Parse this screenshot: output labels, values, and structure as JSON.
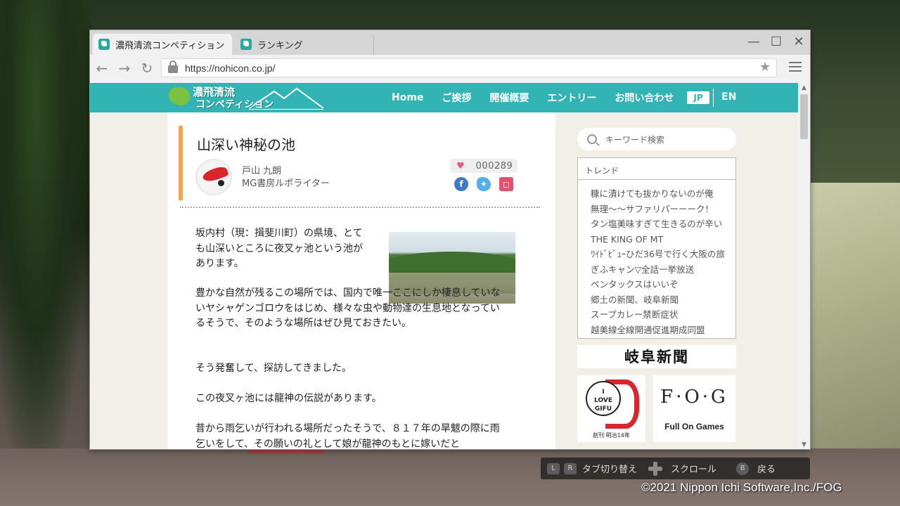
{
  "browser": {
    "tabs": [
      {
        "label": "濃飛清流コンペティション",
        "active": true
      },
      {
        "label": "ランキング",
        "active": false
      }
    ],
    "window_controls": {
      "minimize": "—",
      "maximize": "☐",
      "close": "✕"
    },
    "url": "https://nohicon.co.jp/"
  },
  "site": {
    "logo_line1": "濃飛清流",
    "logo_line2": "コンペティション",
    "nav": [
      "Home",
      "ご挨拶",
      "開催概要",
      "エントリー",
      "お問い合わせ"
    ],
    "lang_jp": "JP",
    "lang_en": "EN",
    "accent_color": "#32b3b4"
  },
  "article": {
    "title": "山深い神秘の池",
    "author_name": "戸山 九朗",
    "author_role": "MG書房ルポライター",
    "likes": "000289",
    "share_icons": [
      "facebook-icon",
      "twitter-icon",
      "instagram-icon"
    ],
    "paragraphs": [
      "坂内村（現：揖斐川町）の県境、とても山深いところに夜叉ヶ池という池があります。",
      "豊かな自然が残るこの場所では、国内で唯一ここにしか棲息していないヤシャゲンゴロウをはじめ、様々な虫や動物達の生息地となっているそうで、そのような場所はぜひ見ておきたい。",
      "そう発奮して、探訪してきました。",
      "この夜叉ヶ池には龍神の伝説があります。",
      "昔から雨乞いが行われる場所だったそうで、８１７年の旱魃の際に雨乞いをして、その願いの礼として娘が龍神のもとに嫁いだと"
    ]
  },
  "sidebar": {
    "search_placeholder": "キーワード検索",
    "trend_title": "トレンド",
    "trends": [
      "糠に漬けても抜かりないのが俺",
      "無理～～サファリパーーーク！",
      "タン塩美味すぎて生きるのが辛い",
      "THE KING OF MT",
      "ﾜｲﾄﾞﾋﾞｭｰひだ36号で行く大阪の旅",
      "ぎふキャン▽全話一挙放送",
      "ペンタックスはいいぞ",
      "郷土の新聞、岐阜新聞",
      "スープカレー禁断症状",
      "越美線全線開通促進期成同盟"
    ],
    "banner_newspaper": "岐阜新聞",
    "banner_love": {
      "line1": "I",
      "line2": "LOVE",
      "line3": "GIFU",
      "caption": "創刊 明治14年"
    },
    "banner_fog": {
      "logo": "F·O·G",
      "name": "Full On Games"
    }
  },
  "controls": {
    "key_l": "L",
    "key_r": "R",
    "tab_switch": "タブ切り替え",
    "scroll": "スクロール",
    "key_b": "B",
    "back": "戻る"
  },
  "copyright": "©2021 Nippon Ichi Software,Inc./FOG"
}
